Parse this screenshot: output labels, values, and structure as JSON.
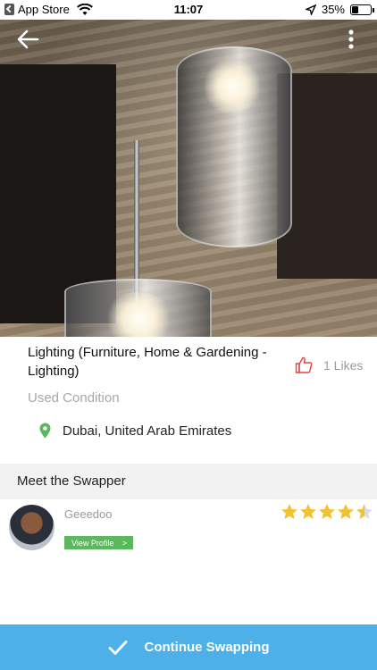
{
  "status_bar": {
    "back_app_label": "App Store",
    "time": "11:07",
    "battery_text": "35%",
    "battery_level": 0.35
  },
  "item": {
    "title": "Lighting  (Furniture, Home & Gardening - Lighting)",
    "likes": "1 Likes",
    "condition": "Used Condition",
    "location": "Dubai, United Arab Emirates"
  },
  "swapper": {
    "section_title": "Meet the Swapper",
    "name": "Geeedoo",
    "view_profile_label": "View Profile",
    "rating": 4.5,
    "rating_max": 5
  },
  "footer": {
    "button_label": "Continue Swapping"
  },
  "colors": {
    "accent_blue": "#4eb0e8",
    "view_profile_green": "#5cb85c",
    "star_gold": "#f2c230",
    "like_red": "#e0443c",
    "pin_green": "#5cb85c"
  }
}
